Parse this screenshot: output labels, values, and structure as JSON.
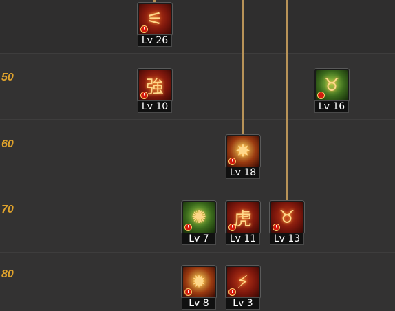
{
  "levels": [
    "50",
    "60",
    "70",
    "80"
  ],
  "skills": [
    {
      "id": "s1",
      "glyph": "⚟",
      "badge": "!",
      "level": "Lv 26",
      "theme": "red"
    },
    {
      "id": "s2",
      "glyph": "強",
      "badge": "!",
      "level": "Lv 10",
      "theme": "red"
    },
    {
      "id": "s3",
      "glyph": "♉",
      "badge": "!",
      "level": "Lv 16",
      "theme": "green"
    },
    {
      "id": "s4",
      "glyph": "✸",
      "badge": "!",
      "level": "Lv 18",
      "theme": "gold"
    },
    {
      "id": "s5",
      "glyph": "✺",
      "badge": "!",
      "level": "Lv 7",
      "theme": "green"
    },
    {
      "id": "s6",
      "glyph": "虎",
      "badge": "!",
      "level": "Lv 11",
      "theme": "red"
    },
    {
      "id": "s7",
      "glyph": "♉",
      "badge": "!",
      "level": "Lv 13",
      "theme": "red"
    },
    {
      "id": "s8",
      "glyph": "✹",
      "badge": "!",
      "level": "Lv 8",
      "theme": "gold"
    },
    {
      "id": "s9",
      "glyph": "⚡",
      "badge": "!",
      "level": "Lv 3",
      "theme": "red"
    }
  ]
}
